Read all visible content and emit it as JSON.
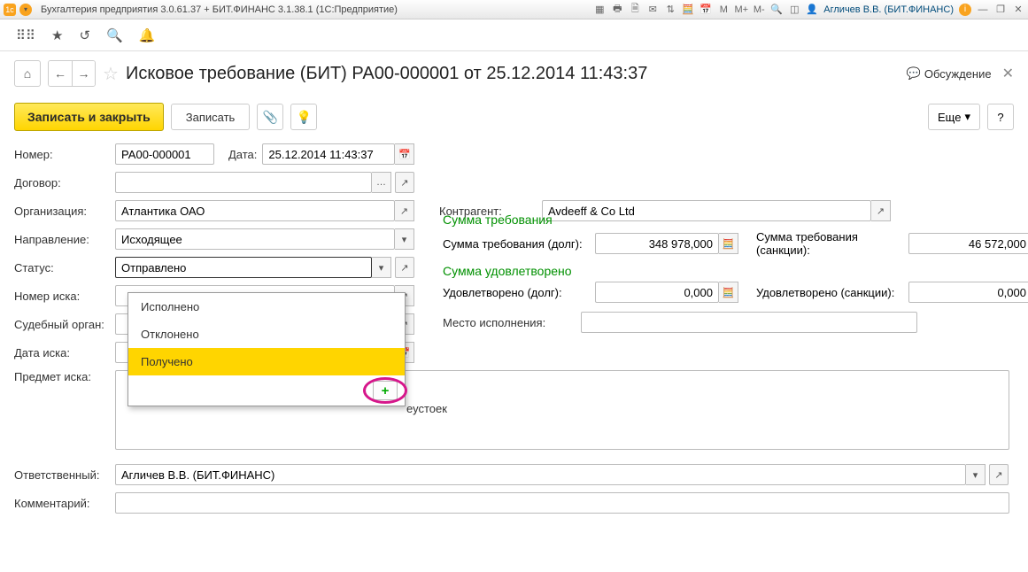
{
  "titlebar": {
    "title": "Бухгалтерия предприятия 3.0.61.37 + БИТ.ФИНАНС 3.1.38.1  (1С:Предприятие)",
    "user": "Агличев В.В. (БИТ.ФИНАНС)",
    "mem_labels": [
      "M",
      "M+",
      "M-"
    ]
  },
  "page": {
    "title": "Исковое требование (БИТ) РА00-000001 от 25.12.2014 11:43:37",
    "discuss": "Обсуждение"
  },
  "actions": {
    "save_close": "Записать и закрыть",
    "save": "Записать",
    "more": "Еще",
    "help": "?"
  },
  "labels": {
    "number": "Номер:",
    "date": "Дата:",
    "contract": "Договор:",
    "org": "Организация:",
    "counter": "Контрагент:",
    "direction": "Направление:",
    "status": "Статус:",
    "claim_no": "Номер иска:",
    "court": "Судебный орган:",
    "claim_date": "Дата иска:",
    "subject": "Предмет иска:",
    "responsible": "Ответственный:",
    "comment": "Комментарий:",
    "sum_req_head": "Сумма требования",
    "sum_req_debt": "Сумма требования (долг):",
    "sum_req_sanc": "Сумма требования (санкции):",
    "sum_sat_head": "Сумма удовлетворено",
    "sat_debt": "Удовлетворено (долг):",
    "sat_sanc": "Удовлетворено (санкции):",
    "place": "Место исполнения:",
    "tail": "еустоек"
  },
  "values": {
    "number": "РА00-000001",
    "date": "25.12.2014 11:43:37",
    "contract": "",
    "org": "Атлантика ОАО",
    "counter": "Avdeeff & Co Ltd",
    "direction": "Исходящее",
    "status": "Отправлено",
    "claim_no": "",
    "court": "",
    "claim_date": "",
    "responsible": "Агличев В.В. (БИТ.ФИНАНС)",
    "comment": "",
    "sum_req_debt": "348 978,000",
    "sum_req_sanc": "46 572,000",
    "sat_debt": "0,000",
    "sat_sanc": "0,000",
    "place": ""
  },
  "status_options": [
    {
      "label": "Исполнено",
      "selected": false
    },
    {
      "label": "Отклонено",
      "selected": false
    },
    {
      "label": "Получено",
      "selected": true
    }
  ]
}
